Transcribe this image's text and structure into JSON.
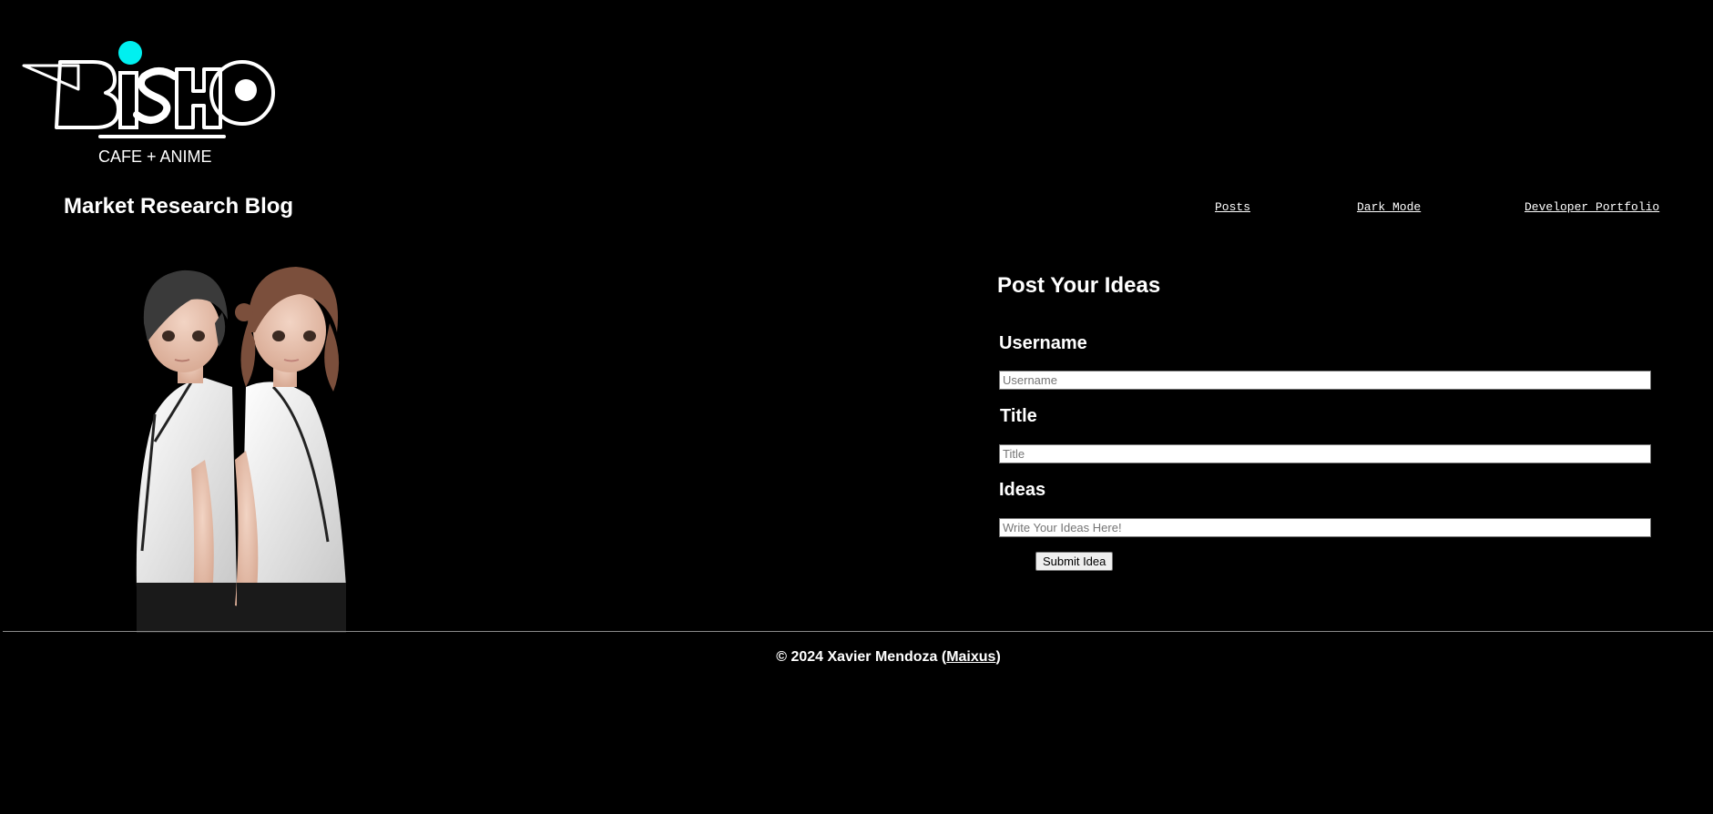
{
  "header": {
    "logo_text": "BISHO",
    "logo_tagline": "CAFE + ANIME",
    "blog_title": "Market Research Blog"
  },
  "nav": {
    "posts": "Posts",
    "dark_mode": "Dark Mode",
    "portfolio": "Developer Portfolio"
  },
  "form": {
    "title": "Post Your Ideas",
    "username_label": "Username",
    "username_placeholder": "Username",
    "title_label": "Title",
    "title_placeholder": "Title",
    "ideas_label": "Ideas",
    "ideas_placeholder": "Write Your Ideas Here!",
    "submit_label": "Submit Idea"
  },
  "footer": {
    "copyright": "© 2024 Xavier Mendoza (",
    "author_link": "Maixus",
    "close": ")"
  },
  "colors": {
    "background": "#000000",
    "text": "#ffffff",
    "logo_accent": "#00f0f0"
  }
}
